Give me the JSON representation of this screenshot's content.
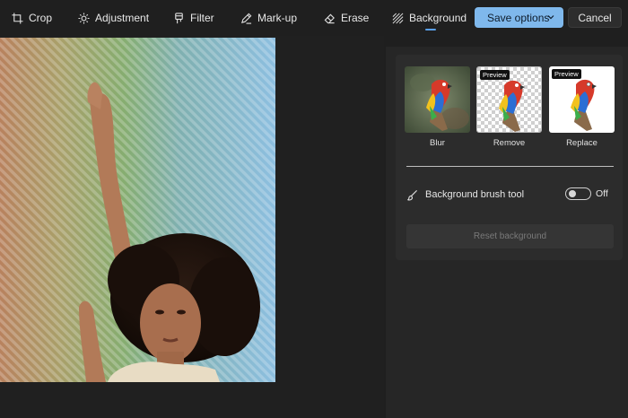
{
  "toolbar": {
    "tools": [
      {
        "label": "Crop",
        "icon": "crop-icon"
      },
      {
        "label": "Adjustment",
        "icon": "sun-icon"
      },
      {
        "label": "Filter",
        "icon": "filter-icon"
      },
      {
        "label": "Mark-up",
        "icon": "pen-icon"
      },
      {
        "label": "Erase",
        "icon": "eraser-icon"
      },
      {
        "label": "Background",
        "icon": "background-icon",
        "active": true
      }
    ],
    "save_label": "Save options",
    "cancel_label": "Cancel"
  },
  "background_panel": {
    "options": [
      {
        "label": "Blur",
        "badge": ""
      },
      {
        "label": "Remove",
        "badge": "Preview"
      },
      {
        "label": "Replace",
        "badge": "Preview"
      }
    ],
    "brush_label": "Background brush tool",
    "toggle_state": "Off",
    "reset_label": "Reset background"
  },
  "colors": {
    "accent": "#7fb8ec",
    "toolbar_bg": "#1f1f1f",
    "panel_bg": "#2c2c2c",
    "active_indicator": "#5aa0ea"
  }
}
